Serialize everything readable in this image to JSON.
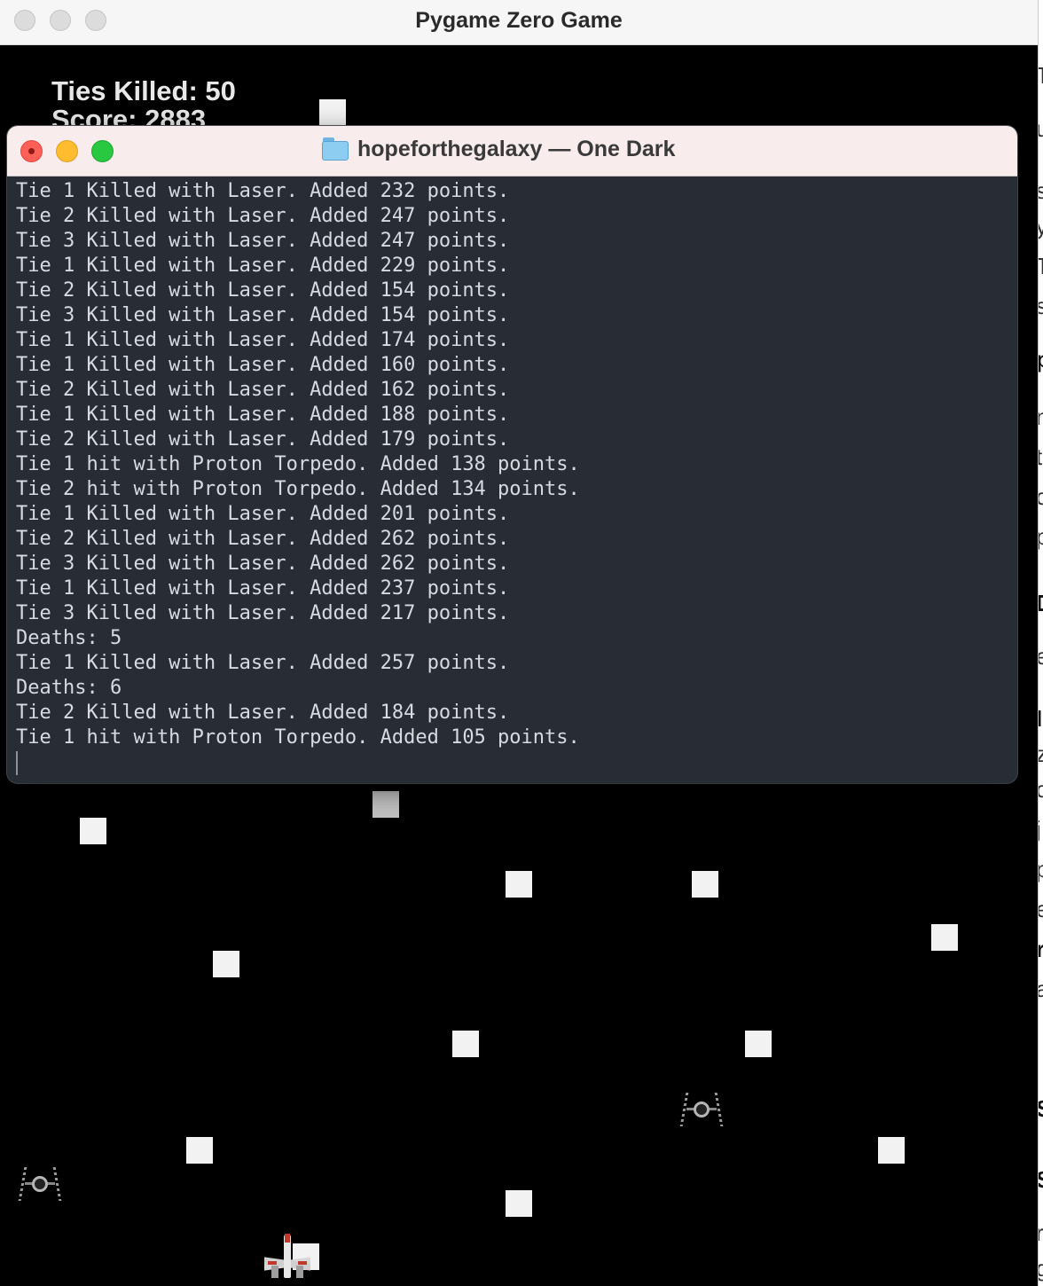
{
  "game_window": {
    "title": "Pygame Zero Game",
    "hud": {
      "ties_killed": "Ties Killed: 50",
      "score": "Score: 2883"
    }
  },
  "terminal_window": {
    "title": "hopeforthegalaxy — One Dark",
    "folder_icon": "folder-icon",
    "lines": [
      "Tie 1 Killed with Laser. Added 232 points.",
      "Tie 2 Killed with Laser. Added 247 points.",
      "Tie 3 Killed with Laser. Added 247 points.",
      "Tie 1 Killed with Laser. Added 229 points.",
      "Tie 2 Killed with Laser. Added 154 points.",
      "Tie 3 Killed with Laser. Added 154 points.",
      "Tie 1 Killed with Laser. Added 174 points.",
      "Tie 1 Killed with Laser. Added 160 points.",
      "Tie 2 Killed with Laser. Added 162 points.",
      "Tie 1 Killed with Laser. Added 188 points.",
      "Tie 2 Killed with Laser. Added 179 points.",
      "Tie 1 hit with Proton Torpedo. Added 138 points.",
      "Tie 2 hit with Proton Torpedo. Added 134 points.",
      "Tie 1 Killed with Laser. Added 201 points.",
      "Tie 2 Killed with Laser. Added 262 points.",
      "Tie 3 Killed with Laser. Added 262 points.",
      "Tie 1 Killed with Laser. Added 237 points.",
      "Tie 3 Killed with Laser. Added 217 points.",
      "Deaths: 5",
      "Tie 1 Killed with Laser. Added 257 points.",
      "Deaths: 6",
      "Tie 2 Killed with Laser. Added 184 points.",
      "Tie 1 hit with Proton Torpedo. Added 105 points."
    ]
  },
  "colors": {
    "terminal_bg": "#282c34",
    "terminal_text": "#d7dae0",
    "game_bg": "#000000",
    "close_button": "#fe5f57",
    "minimize_button": "#febc2e",
    "maximize_button": "#28c840"
  }
}
